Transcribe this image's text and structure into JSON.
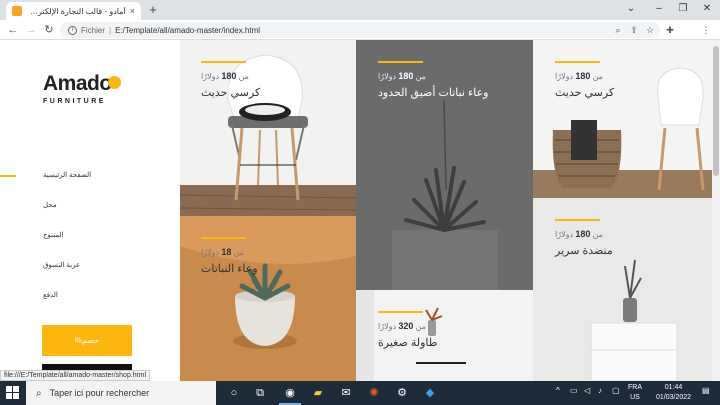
{
  "browser": {
    "tab_title": "أمادو - قالب التجارة الإلكترونية للأثاث",
    "tab_close": "×",
    "new_tab": "+",
    "url_scheme_label": "Fichier",
    "url_separator": "|",
    "url": "E:/Template/all/amado-master/index.html",
    "status_url": "file:///E:/Template/all/amado-master/shop.html"
  },
  "sidebar": {
    "logo": "Amado",
    "logo_sub": "FURNITURE",
    "nav": [
      {
        "label": "الصفحة الرئيسية"
      },
      {
        "label": "محل"
      },
      {
        "label": "المنتوج"
      },
      {
        "label": "عربة التسوق"
      },
      {
        "label": "الدفع"
      }
    ],
    "discount_button": "%خصم"
  },
  "products": [
    {
      "price_prefix": "من",
      "price": "180",
      "currency": "دولارًا",
      "name": "كرسي حديث"
    },
    {
      "price_prefix": "من",
      "price": "180",
      "currency": "دولارًا",
      "name": "وعاء نباتات أضيق الحدود"
    },
    {
      "price_prefix": "من",
      "price": "180",
      "currency": "دولارًا",
      "name": "كرسي حديث"
    },
    {
      "price_prefix": "من",
      "price": "18",
      "currency": "دولارًا",
      "name": "وعاء النباتات"
    },
    {
      "price_prefix": "من",
      "price": "180",
      "currency": "دولارًا",
      "name": "منضدة سرير"
    },
    {
      "price_prefix": "من",
      "price": "320",
      "currency": "دولارًا",
      "name": "طاولة صغيرة"
    }
  ],
  "taskbar": {
    "search_placeholder": "Taper ici pour rechercher",
    "lang_line1": "FRA",
    "lang_line2": "US",
    "time": "01:44",
    "date": "01/03/2022"
  },
  "colors": {
    "accent": "#fbb710",
    "taskbar": "#1e2b38"
  }
}
